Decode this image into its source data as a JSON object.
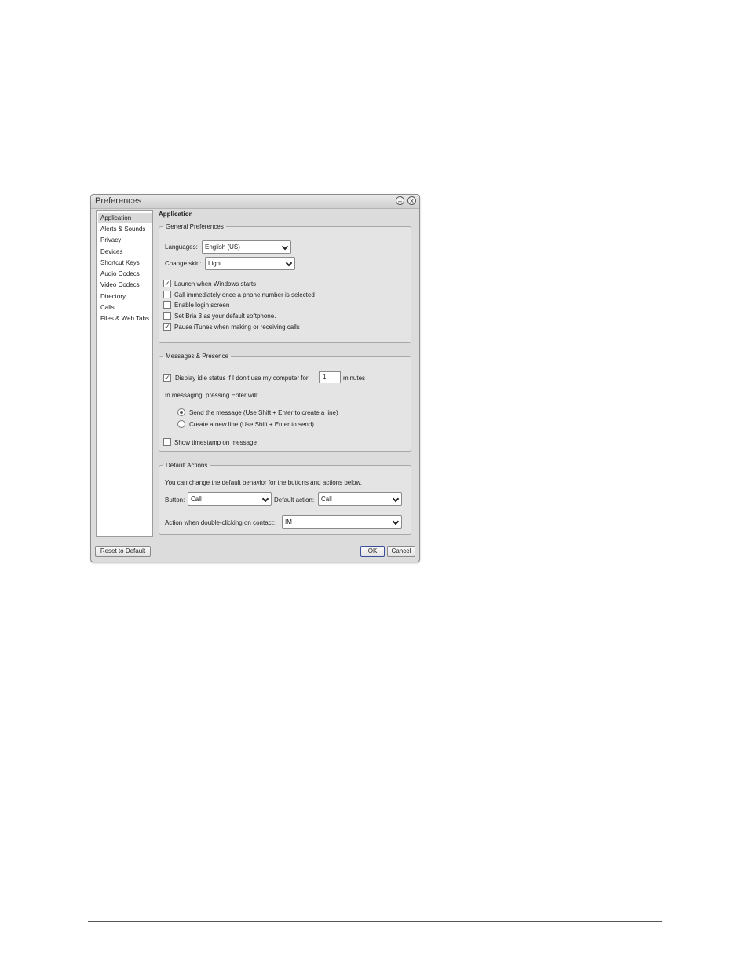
{
  "window": {
    "title": "Preferences",
    "minimize_icon": "minimize-icon",
    "close_icon": "close-icon"
  },
  "sidebar": {
    "items": [
      {
        "label": "Application",
        "selected": true
      },
      {
        "label": "Alerts & Sounds"
      },
      {
        "label": "Privacy"
      },
      {
        "label": "Devices"
      },
      {
        "label": "Shortcut Keys"
      },
      {
        "label": "Audio Codecs"
      },
      {
        "label": "Video Codecs"
      },
      {
        "label": "Directory"
      },
      {
        "label": "Calls"
      },
      {
        "label": "Files & Web Tabs"
      }
    ]
  },
  "main": {
    "section_title": "Application",
    "general": {
      "legend": "General Preferences",
      "languages_label": "Languages:",
      "languages_value": "English (US)",
      "skin_label": "Change skin:",
      "skin_value": "Light",
      "checkboxes": [
        {
          "label": "Launch when Windows starts",
          "checked": true
        },
        {
          "label": "Call immediately once a phone number is selected",
          "checked": false
        },
        {
          "label": "Enable login screen",
          "checked": false
        },
        {
          "label": "Set Bria 3 as your default softphone.",
          "checked": false
        },
        {
          "label": "Pause iTunes when making or receiving calls",
          "checked": true
        }
      ]
    },
    "messages": {
      "legend": "Messages & Presence",
      "idle_label": "Display idle status if I don't use my computer for",
      "idle_checked": true,
      "idle_value": "1",
      "idle_unit": "minutes",
      "enter_label": "In messaging, pressing Enter will:",
      "radio_send": "Send the message (Use Shift + Enter to create a line)",
      "radio_newline": "Create a new line (Use Shift + Enter to send)",
      "selected_radio": "send",
      "timestamp_label": "Show timestamp on message",
      "timestamp_checked": false
    },
    "default_actions": {
      "legend": "Default Actions",
      "description": "You can change the default behavior for the buttons and actions below.",
      "button_label": "Button:",
      "button_value": "Call",
      "default_action_label": "Default action:",
      "default_action_value": "Call",
      "double_click_label": "Action when double-clicking on contact:",
      "double_click_value": "IM"
    }
  },
  "footer": {
    "reset_label": "Reset to Default",
    "ok_label": "OK",
    "cancel_label": "Cancel"
  }
}
